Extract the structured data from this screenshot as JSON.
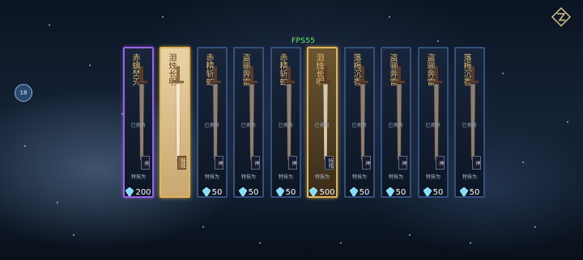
{
  "hud": {
    "fps": "FPS55",
    "side_bubble": "18"
  },
  "colors": {
    "frame_blue": "#33507e",
    "frame_purple": "#9a62e4",
    "frame_gold": "#e3b457",
    "name_gold": "#e4b769"
  },
  "cards": [
    {
      "name": "赤螭焚天",
      "owned": "已拥有",
      "tag": "绝",
      "skill": "特技为",
      "price": "200",
      "frame": "purple",
      "style": "dark"
    },
    {
      "name": "泪烛长明",
      "owned": "",
      "tag": "特戏",
      "skill": "",
      "price": "",
      "frame": "gold",
      "style": "light"
    },
    {
      "name": "赤精斩蛇",
      "owned": "已拥有",
      "tag": "神",
      "skill": "特技为",
      "price": "50",
      "frame": "blue",
      "style": "dark"
    },
    {
      "name": "盗骊奔雷",
      "owned": "已拥有",
      "tag": "神",
      "skill": "特技为",
      "price": "50",
      "frame": "blue",
      "style": "dark"
    },
    {
      "name": "赤精斩蛇",
      "owned": "已拥有",
      "tag": "神",
      "skill": "特技为",
      "price": "50",
      "frame": "blue",
      "style": "dark"
    },
    {
      "name": "泪烛长明",
      "owned": "已拥有",
      "tag": "特戏",
      "skill": "特技为",
      "price": "500",
      "frame": "gold",
      "style": "darkgold"
    },
    {
      "name": "落梅沉香",
      "owned": "已拥有",
      "tag": "神",
      "skill": "特技为",
      "price": "50",
      "frame": "blue",
      "style": "dark"
    },
    {
      "name": "盗骊奔雷",
      "owned": "已拥有",
      "tag": "神",
      "skill": "特技为",
      "price": "50",
      "frame": "blue",
      "style": "dark"
    },
    {
      "name": "盗骊奔雷",
      "owned": "已拥有",
      "tag": "神",
      "skill": "特技为",
      "price": "50",
      "frame": "blue",
      "style": "dark"
    },
    {
      "name": "落梅沉香",
      "owned": "已拥有",
      "tag": "神",
      "skill": "特技为",
      "price": "50",
      "frame": "blue",
      "style": "dark"
    }
  ]
}
